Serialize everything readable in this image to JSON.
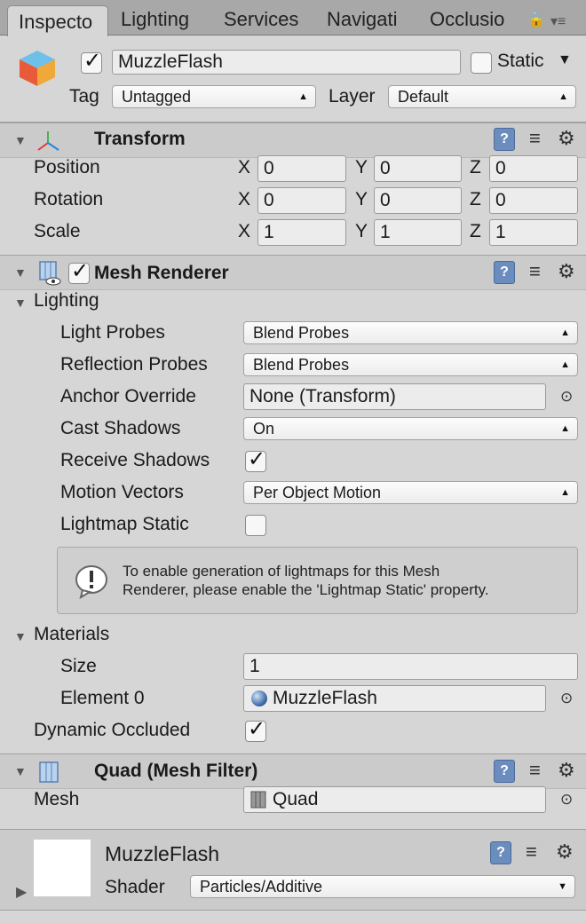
{
  "tabs": [
    "Inspecto",
    "Lighting",
    "Services",
    "Navigati",
    "Occlusio"
  ],
  "object": {
    "active_checked": true,
    "name": "MuzzleFlash",
    "static_label": "Static",
    "static_checked": false,
    "tag_label": "Tag",
    "tag_value": "Untagged",
    "layer_label": "Layer",
    "layer_value": "Default"
  },
  "transform": {
    "title": "Transform",
    "rows": [
      {
        "label": "Position",
        "x": "0",
        "y": "0",
        "z": "0"
      },
      {
        "label": "Rotation",
        "x": "0",
        "y": "0",
        "z": "0"
      },
      {
        "label": "Scale",
        "x": "1",
        "y": "1",
        "z": "1"
      }
    ],
    "axis_x": "X",
    "axis_y": "Y",
    "axis_z": "Z"
  },
  "mesh_renderer": {
    "title": "Mesh Renderer",
    "enabled": true,
    "lighting_label": "Lighting",
    "light_probes_label": "Light Probes",
    "light_probes_value": "Blend Probes",
    "reflection_probes_label": "Reflection Probes",
    "reflection_probes_value": "Blend Probes",
    "anchor_override_label": "Anchor Override",
    "anchor_override_value": "None (Transform)",
    "cast_shadows_label": "Cast Shadows",
    "cast_shadows_value": "On",
    "receive_shadows_label": "Receive Shadows",
    "receive_shadows_checked": true,
    "motion_vectors_label": "Motion Vectors",
    "motion_vectors_value": "Per Object Motion",
    "lightmap_static_label": "Lightmap Static",
    "lightmap_static_checked": false,
    "help_line1": "To enable generation of lightmaps for this Mesh",
    "help_line2": "Renderer, please enable the 'Lightmap Static' property.",
    "materials_label": "Materials",
    "size_label": "Size",
    "size_value": "1",
    "element0_label": "Element 0",
    "element0_value": "MuzzleFlash",
    "dynamic_occluded_label": "Dynamic Occluded",
    "dynamic_occluded_checked": true
  },
  "mesh_filter": {
    "title": "Quad (Mesh Filter)",
    "mesh_label": "Mesh",
    "mesh_value": "Quad"
  },
  "material": {
    "name": "MuzzleFlash",
    "shader_label": "Shader",
    "shader_value": "Particles/Additive"
  },
  "colors": {
    "background": "#d6d6d6",
    "header": "#cbcbcb",
    "tabbar": "#a8a8a8",
    "field": "#ececec"
  }
}
